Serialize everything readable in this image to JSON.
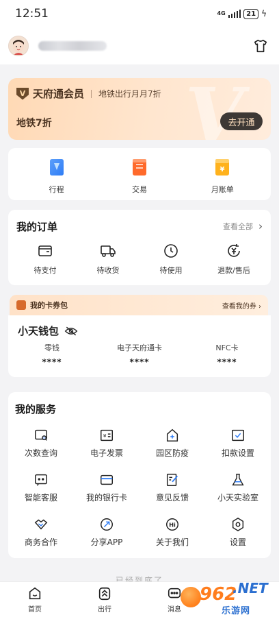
{
  "status_bar": {
    "time": "12:51",
    "network": "4G",
    "battery": "21"
  },
  "profile": {
    "username": ""
  },
  "member": {
    "title": "天府通会员",
    "desc": "地铁出行月月7折",
    "subtitle": "地铁7折",
    "button": "去开通"
  },
  "quick": [
    {
      "label": "行程",
      "icon": "trip-icon",
      "color": "#2f7df6"
    },
    {
      "label": "交易",
      "icon": "transaction-icon",
      "color": "#ff6a2b"
    },
    {
      "label": "月账单",
      "icon": "monthly-bill-icon",
      "color": "#ffb21d"
    }
  ],
  "orders": {
    "title": "我的订单",
    "view_all": "查看全部",
    "items": [
      {
        "label": "待支付",
        "icon": "wallet-icon"
      },
      {
        "label": "待收货",
        "icon": "truck-icon"
      },
      {
        "label": "待使用",
        "icon": "clock-icon"
      },
      {
        "label": "退款/售后",
        "icon": "refund-icon"
      }
    ]
  },
  "coupon": {
    "title": "我的卡券包",
    "view": "查看我的券"
  },
  "wallet": {
    "title": "小天钱包",
    "items": [
      {
        "label": "零钱",
        "value": "****"
      },
      {
        "label": "电子天府通卡",
        "value": "****"
      },
      {
        "label": "NFC卡",
        "value": "****"
      }
    ]
  },
  "services": {
    "title": "我的服务",
    "items": [
      {
        "label": "次数查询",
        "icon": "count-query-icon"
      },
      {
        "label": "电子发票",
        "icon": "e-invoice-icon"
      },
      {
        "label": "园区防疫",
        "icon": "epidemic-icon"
      },
      {
        "label": "扣款设置",
        "icon": "deduction-settings-icon"
      },
      {
        "label": "智能客服",
        "icon": "customer-service-icon"
      },
      {
        "label": "我的银行卡",
        "icon": "bank-card-icon"
      },
      {
        "label": "意见反馈",
        "icon": "feedback-icon"
      },
      {
        "label": "小天实验室",
        "icon": "lab-icon"
      },
      {
        "label": "商务合作",
        "icon": "handshake-icon"
      },
      {
        "label": "分享APP",
        "icon": "share-icon"
      },
      {
        "label": "关于我们",
        "icon": "about-icon"
      },
      {
        "label": "设置",
        "icon": "settings-icon"
      }
    ]
  },
  "end_text": "已经到底了",
  "bottom_nav": [
    {
      "label": "首页",
      "icon": "home-icon"
    },
    {
      "label": "出行",
      "icon": "travel-icon"
    },
    {
      "label": "消息",
      "icon": "message-icon"
    }
  ],
  "watermark": {
    "number": "962",
    "net": ".NET",
    "site": "乐游网"
  },
  "colors": {
    "accent_dark": "#3d3835",
    "member_bg": "#ffe3c9",
    "page_bg": "#f3f3f5"
  }
}
